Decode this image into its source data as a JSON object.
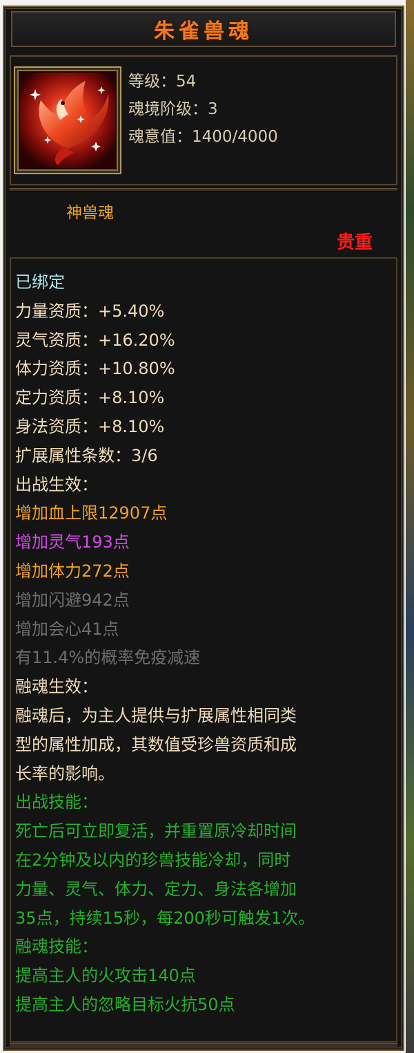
{
  "title": "朱雀兽魂",
  "stats": {
    "level": "等级：54",
    "realm_tier": "魂境阶级：3",
    "soul_value": "魂意值：1400/4000"
  },
  "type_label": "神兽魂",
  "rarity": "贵重",
  "details": {
    "bound": "已绑定",
    "strength": "力量资质：+5.40%",
    "spirit": "灵气资质：+16.20%",
    "stamina": "体力资质：+10.80%",
    "focus": "定力资质：+8.10%",
    "agility": "身法资质：+8.10%",
    "ext_count": "扩展属性条数：3/6",
    "battle_effect_header": "出战生效：",
    "effect_hp": "增加血上限12907点",
    "effect_spirit": "增加灵气193点",
    "effect_stamina": "增加体力272点",
    "effect_dodge": "增加闪避942点",
    "effect_crit": "增加会心41点",
    "effect_immune": "有11.4%的概率免疫减速",
    "fusion_effect_header": "融魂生效：",
    "fusion_effect_desc_1": "融魂后，为主人提供与扩展属性相同类",
    "fusion_effect_desc_2": "型的属性加成，其数值受珍兽资质和成",
    "fusion_effect_desc_3": "长率的影响。",
    "battle_skill_header": "出战技能：",
    "battle_skill_desc_1": "死亡后可立即复活，并重置原冷却时间",
    "battle_skill_desc_2": "在2分钟及以内的珍兽技能冷却，同时",
    "battle_skill_desc_3": "力量、灵气、体力、定力、身法各增加",
    "battle_skill_desc_4": "35点，持续15秒，每200秒可触发1次。",
    "fusion_skill_header": "融魂技能：",
    "fusion_skill_1": "提高主人的火攻击140点",
    "fusion_skill_2": "提高主人的忽略目标火抗50点"
  },
  "colors": {
    "title": "#f07a1e",
    "rarity": "#ff1a1a",
    "bound": "#aee6ee",
    "orange": "#f2a21a",
    "purple": "#d34ae6",
    "inactive": "#6e6e6e",
    "skill": "#27b02e"
  },
  "icon": "vermilion-bird-phoenix-icon"
}
